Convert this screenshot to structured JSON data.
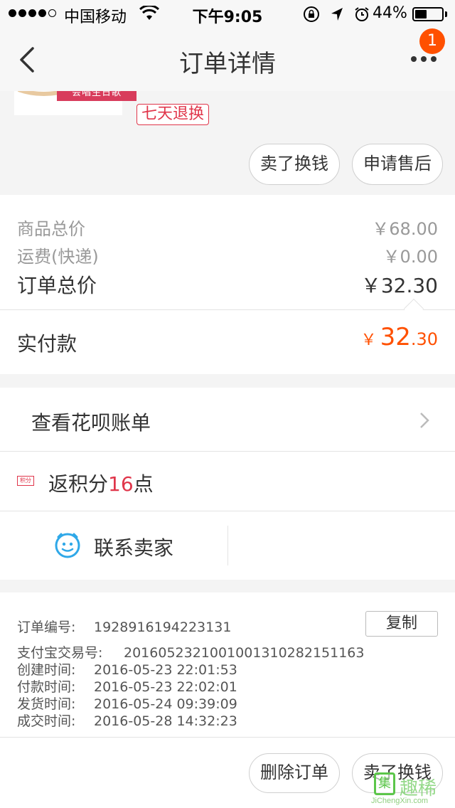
{
  "status_bar": {
    "carrier": "中国移动",
    "time": "下午9:05",
    "battery_pct": "44%",
    "battery_level": 0.44,
    "signal_bars": 4
  },
  "nav": {
    "title": "订单详情",
    "badge": "1",
    "back_icon": "chevron-left-icon",
    "more_icon": "more-dots-icon"
  },
  "product": {
    "thumb_ribbon": "会唱生日歌",
    "tag": "七天退换",
    "sell_button": "卖了换钱",
    "aftersale_button": "申请售后"
  },
  "price": {
    "items_label": "商品总价",
    "items_value": "￥68.00",
    "shipping_label": "运费(快递)",
    "shipping_value": "￥0.00",
    "total_label": "订单总价",
    "total_value": "￥32.30",
    "paid_label": "实付款",
    "paid_currency": "￥",
    "paid_int": "32",
    "paid_dec": ".30"
  },
  "actions": {
    "huabei": "查看花呗账单",
    "points_icon": "积分",
    "points_prefix": "返积分",
    "points_num": "16",
    "points_suffix": "点",
    "contact": "联系卖家"
  },
  "order_info": {
    "order_no_label": "订单编号:",
    "order_no": "1928916194223131",
    "copy_button": "复制",
    "alipay_label": "支付宝交易号:",
    "alipay_no": "2016052321001001310282151163",
    "created_label": "创建时间:",
    "created": "2016-05-23 22:01:53",
    "paid_label": "付款时间:",
    "paid": "2016-05-23 22:02:01",
    "shipped_label": "发货时间:",
    "shipped": "2016-05-24 09:39:09",
    "closed_label": "成交时间:",
    "closed": "2016-05-28 14:32:23"
  },
  "footer": {
    "delete_button": "删除订单",
    "sell_button": "卖了换钱"
  },
  "watermark": {
    "box_char": "集",
    "mark": "趣稀",
    "url": "JiChengXin.com"
  },
  "colors": {
    "accent": "#ff5000",
    "tag_red": "#e0354a",
    "contact_blue": "#2fa8e8"
  }
}
